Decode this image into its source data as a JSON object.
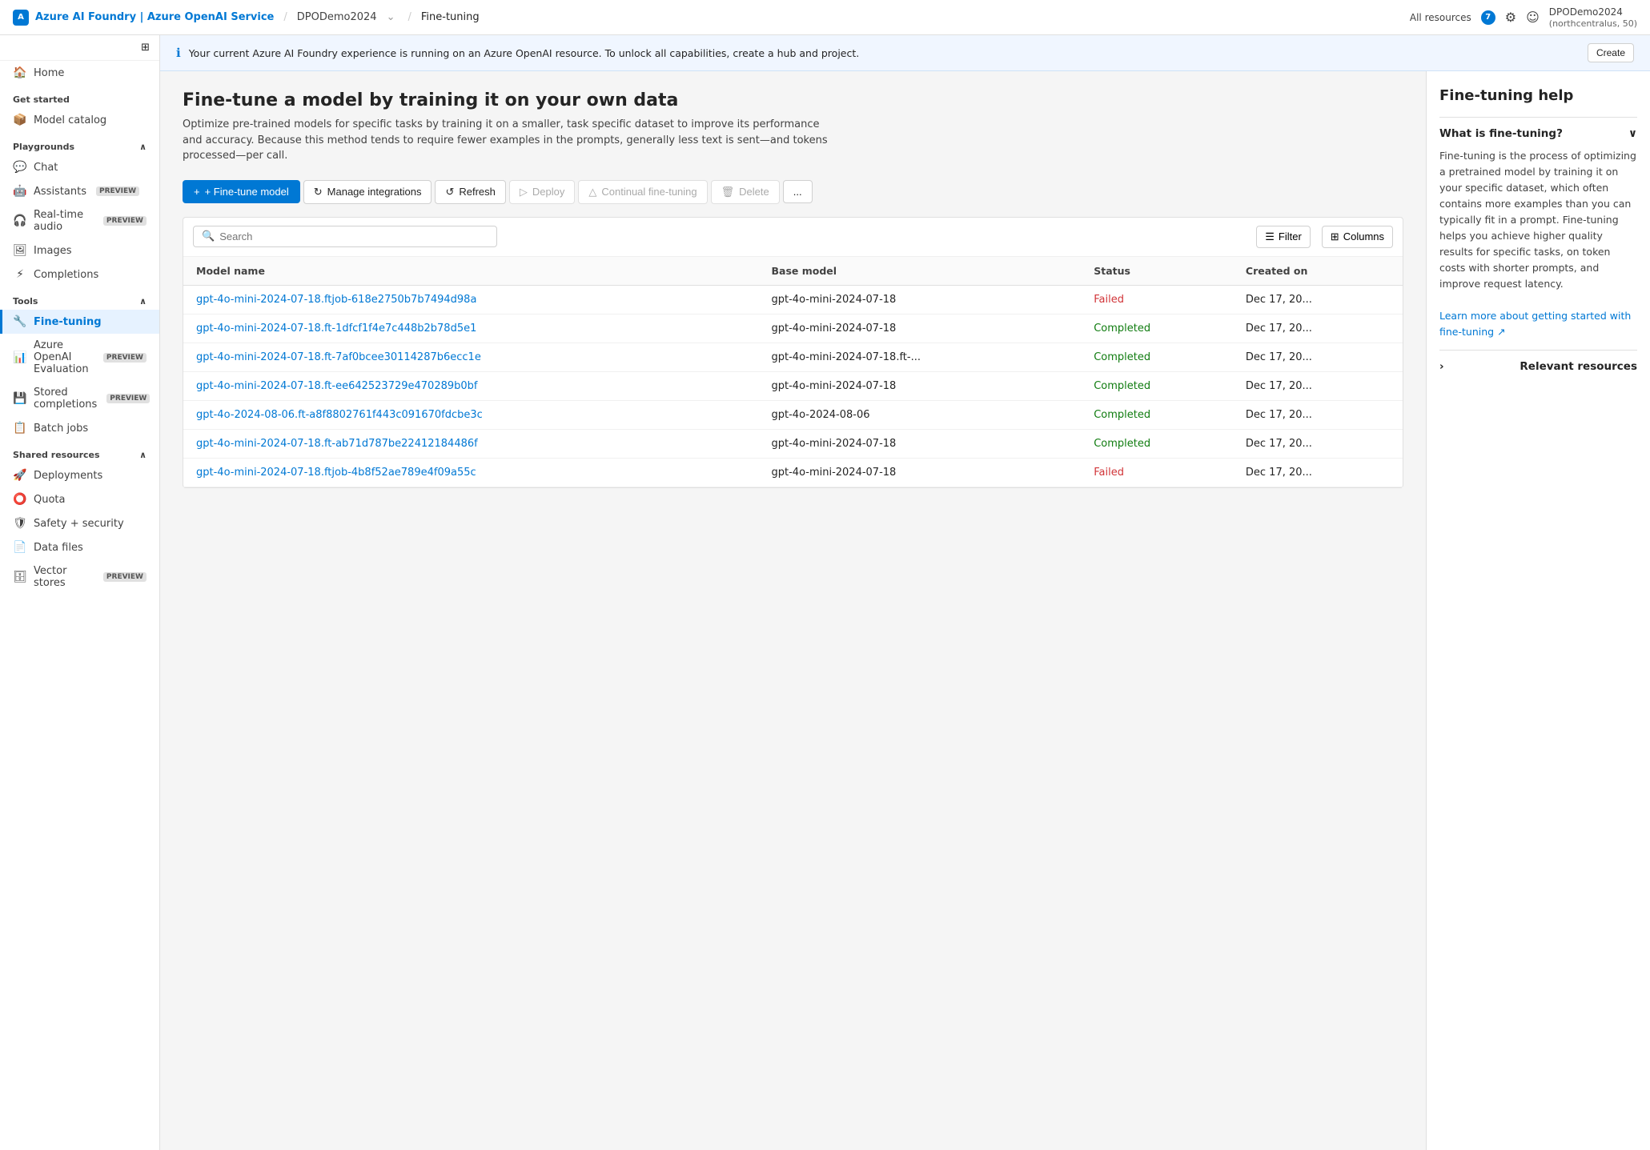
{
  "topNav": {
    "brand": "Azure AI Foundry | Azure OpenAI Service",
    "brandIcon": "A",
    "breadcrumbs": [
      {
        "label": "DPODemo2024",
        "hasChevron": true
      },
      {
        "label": "Fine-tuning",
        "active": true
      }
    ],
    "allResources": "All resources",
    "resourceCount": "7",
    "userAccount": "DPODemo2024",
    "userLocation": "(northcentralus, 50)"
  },
  "infoBanner": {
    "text": "Your current Azure AI Foundry experience is running on an Azure OpenAI resource. To unlock all capabilities, create a hub and project."
  },
  "sidebar": {
    "home": "Home",
    "getStarted": "Get started",
    "modelCatalog": "Model catalog",
    "playgrounds": {
      "label": "Playgrounds",
      "expanded": true
    },
    "playgroundItems": [
      {
        "id": "chat",
        "label": "Chat",
        "icon": "💬"
      },
      {
        "id": "assistants",
        "label": "Assistants",
        "icon": "🤖",
        "preview": "PREVIEW"
      },
      {
        "id": "realtime-audio",
        "label": "Real-time audio",
        "icon": "🎧",
        "preview": "PREVIEW"
      },
      {
        "id": "images",
        "label": "Images",
        "icon": "🖼"
      },
      {
        "id": "completions",
        "label": "Completions",
        "icon": "⚡"
      }
    ],
    "tools": {
      "label": "Tools",
      "expanded": true
    },
    "toolItems": [
      {
        "id": "fine-tuning",
        "label": "Fine-tuning",
        "icon": "🔧",
        "active": true
      },
      {
        "id": "azure-openai-eval",
        "label": "Azure OpenAI Evaluation",
        "icon": "📊",
        "preview": "PREVIEW"
      },
      {
        "id": "stored-completions",
        "label": "Stored completions",
        "icon": "💾",
        "preview": "PREVIEW"
      },
      {
        "id": "batch-jobs",
        "label": "Batch jobs",
        "icon": "📋"
      }
    ],
    "sharedResources": {
      "label": "Shared resources",
      "expanded": true
    },
    "sharedItems": [
      {
        "id": "deployments",
        "label": "Deployments",
        "icon": "🚀"
      },
      {
        "id": "quota",
        "label": "Quota",
        "icon": "⭕"
      },
      {
        "id": "safety-security",
        "label": "Safety + security",
        "icon": "🛡"
      },
      {
        "id": "data-files",
        "label": "Data files",
        "icon": "📄"
      },
      {
        "id": "vector-stores",
        "label": "Vector stores",
        "icon": "🗄",
        "preview": "PREVIEW"
      }
    ]
  },
  "page": {
    "title": "Fine-tune a model by training it on your own data",
    "description": "Optimize pre-trained models for specific tasks by training it on a smaller, task specific dataset to improve its performance and accuracy. Because this method tends to require fewer examples in the prompts, generally less text is sent—and tokens processed—per call."
  },
  "toolbar": {
    "fineTuneModel": "+ Fine-tune model",
    "manageIntegrations": "Manage integrations",
    "refresh": "Refresh",
    "deploy": "Deploy",
    "continualFineTuning": "Continual fine-tuning",
    "delete": "Delete",
    "more": "..."
  },
  "table": {
    "searchPlaceholder": "Search",
    "filterLabel": "Filter",
    "columnsLabel": "Columns",
    "columns": [
      "Model name",
      "Base model",
      "Status",
      "Created on"
    ],
    "rows": [
      {
        "modelName": "gpt-4o-mini-2024-07-18.ftjob-618e2750b7b7494d98a",
        "baseModel": "gpt-4o-mini-2024-07-18",
        "status": "Failed",
        "createdOn": "Dec 17, 20..."
      },
      {
        "modelName": "gpt-4o-mini-2024-07-18.ft-1dfcf1f4e7c448b2b78d5e1",
        "baseModel": "gpt-4o-mini-2024-07-18",
        "status": "Completed",
        "createdOn": "Dec 17, 20..."
      },
      {
        "modelName": "gpt-4o-mini-2024-07-18.ft-7af0bcee30114287b6ecc1e",
        "baseModel": "gpt-4o-mini-2024-07-18.ft-...",
        "status": "Completed",
        "createdOn": "Dec 17, 20..."
      },
      {
        "modelName": "gpt-4o-mini-2024-07-18.ft-ee642523729e470289b0bf",
        "baseModel": "gpt-4o-mini-2024-07-18",
        "status": "Completed",
        "createdOn": "Dec 17, 20..."
      },
      {
        "modelName": "gpt-4o-2024-08-06.ft-a8f8802761f443c091670fdcbe3c",
        "baseModel": "gpt-4o-2024-08-06",
        "status": "Completed",
        "createdOn": "Dec 17, 20..."
      },
      {
        "modelName": "gpt-4o-mini-2024-07-18.ft-ab71d787be22412184486f",
        "baseModel": "gpt-4o-mini-2024-07-18",
        "status": "Completed",
        "createdOn": "Dec 17, 20..."
      },
      {
        "modelName": "gpt-4o-mini-2024-07-18.ftjob-4b8f52ae789e4f09a55c",
        "baseModel": "gpt-4o-mini-2024-07-18",
        "status": "Failed",
        "createdOn": "Dec 17, 20..."
      }
    ]
  },
  "helpPanel": {
    "title": "Fine-tuning help",
    "sections": [
      {
        "id": "what-is-fine-tuning",
        "label": "What is fine-tuning?",
        "expanded": true,
        "content": "Fine-tuning is the process of optimizing a pretrained model by training it on your specific dataset, which often contains more examples than you can typically fit in a prompt. Fine-tuning helps you achieve higher quality results for specific tasks, on token costs with shorter prompts, and improve request latency.",
        "linkText": "Learn more about getting started with fine-tuning ↗"
      },
      {
        "id": "relevant-resources",
        "label": "Relevant resources",
        "expanded": false,
        "content": ""
      }
    ]
  }
}
